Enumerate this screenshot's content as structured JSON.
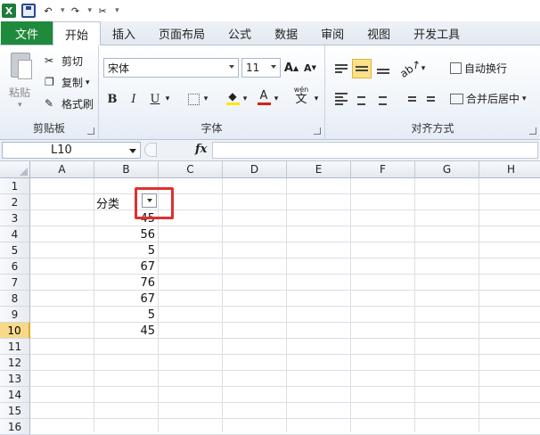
{
  "qat": {
    "items": [
      "excel-logo",
      "save",
      "undo",
      "redo",
      "tools",
      "customize"
    ]
  },
  "tabs": {
    "file": "文件",
    "items": [
      "开始",
      "插入",
      "页面布局",
      "公式",
      "数据",
      "审阅",
      "视图",
      "开发工具"
    ],
    "active": "开始"
  },
  "ribbon": {
    "clipboard": {
      "label": "剪贴板",
      "paste": "粘贴",
      "cut": "剪切",
      "copy": "复制",
      "format_painter": "格式刷"
    },
    "font": {
      "label": "字体",
      "font_name": "宋体",
      "font_size": "11",
      "grow": "A",
      "shrink": "A",
      "bold": "B",
      "italic": "I",
      "underline": "U",
      "font_color_glyph": "A",
      "phonetic": "wén",
      "phonetic_char": "文"
    },
    "alignment": {
      "label": "对齐方式",
      "wrap_text": "自动换行",
      "merge_center": "合并后居中"
    }
  },
  "formula_bar": {
    "name_box": "L10",
    "fx": "fx",
    "formula": ""
  },
  "sheet": {
    "columns": [
      "A",
      "B",
      "C",
      "D",
      "E",
      "F",
      "G",
      "H"
    ],
    "rows": [
      "1",
      "2",
      "3",
      "4",
      "5",
      "6",
      "7",
      "8",
      "9",
      "10",
      "11",
      "12",
      "13",
      "14",
      "15",
      "16"
    ],
    "selected_row": "10",
    "header_label": "分类",
    "values": [
      "45",
      "56",
      "5",
      "67",
      "76",
      "67",
      "5",
      "45"
    ]
  },
  "colors": {
    "file_tab": "#1f8a3c",
    "highlight_box": "#e0302e",
    "selected_row_header": "#f8d98a"
  }
}
